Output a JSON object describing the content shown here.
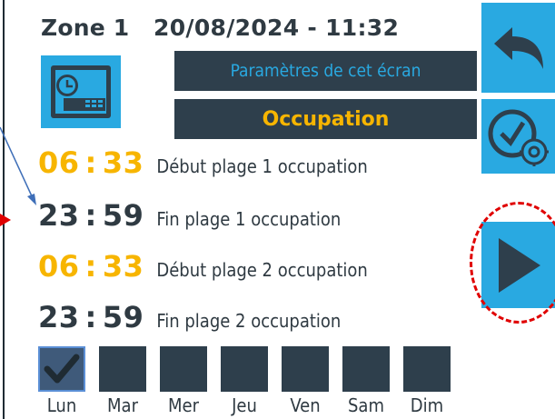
{
  "header": {
    "zone": "Zone 1",
    "datetime": "20/08/2024 - 11:32"
  },
  "buttons": {
    "params_label": "Paramètres de cet écran",
    "mode_title": "Occupation"
  },
  "icons": {
    "schedule": "schedule-calendar-clock-icon",
    "back": "back-arrow-icon",
    "clock_settings": "clock-gear-icon",
    "next": "play-next-icon",
    "check": "checkmark-icon"
  },
  "rows": [
    {
      "hour": "06",
      "sep": ":",
      "minute": "33",
      "label": "Début plage 1 occupation"
    },
    {
      "hour": "23",
      "sep": ":",
      "minute": "59",
      "label": "Fin plage 1 occupation"
    },
    {
      "hour": "06",
      "sep": ":",
      "minute": "33",
      "label": "Début plage 2 occupation"
    },
    {
      "hour": "23",
      "sep": ":",
      "minute": "59",
      "label": "Fin plage 2 occupation"
    }
  ],
  "days": [
    {
      "label": "Lun",
      "checked": true
    },
    {
      "label": "Mar",
      "checked": false
    },
    {
      "label": "Mer",
      "checked": false
    },
    {
      "label": "Jeu",
      "checked": false
    },
    {
      "label": "Ven",
      "checked": false
    },
    {
      "label": "Sam",
      "checked": false
    },
    {
      "label": "Dim",
      "checked": false
    }
  ],
  "colors": {
    "accent_blue": "#29a9e1",
    "panel_dark": "#2e3f4c",
    "highlight_orange": "#f7b500",
    "text_dark": "#2f3a42",
    "annotation_red": "#e00000",
    "annotation_blue": "#3f6fb8"
  }
}
